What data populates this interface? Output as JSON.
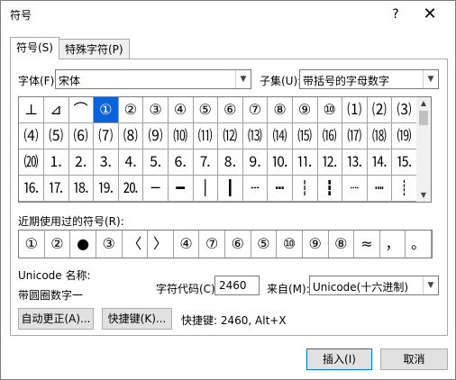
{
  "window": {
    "title": "符号",
    "help": "?",
    "close": "✕"
  },
  "tabs": [
    {
      "label": "符号(S)"
    },
    {
      "label": "特殊字符(P)"
    }
  ],
  "font": {
    "label": "字体(F):",
    "value": "宋体"
  },
  "subset": {
    "label": "子集(U):",
    "value": "带括号的字母数字"
  },
  "symbol_grid": {
    "selected_index": 3,
    "rows": [
      [
        "⊥",
        "⊿",
        "⌒",
        "①",
        "②",
        "③",
        "④",
        "⑤",
        "⑥",
        "⑦",
        "⑧",
        "⑨",
        "⑩",
        "⑴",
        "⑵",
        "⑶"
      ],
      [
        "⑷",
        "⑸",
        "⑹",
        "⑺",
        "⑻",
        "⑼",
        "⑽",
        "⑾",
        "⑿",
        "⒀",
        "⒁",
        "⒂",
        "⒃",
        "⒄",
        "⒅",
        "⒆"
      ],
      [
        "⒇",
        "⒈",
        "⒉",
        "⒊",
        "⒋",
        "⒌",
        "⒍",
        "⒎",
        "⒏",
        "⒐",
        "⒑",
        "⒒",
        "⒓",
        "⒔",
        "⒕",
        "⒖"
      ],
      [
        "⒗",
        "⒘",
        "⒙",
        "⒚",
        "⒛",
        "─",
        "━",
        "│",
        "┃",
        "┄",
        "┅",
        "┆",
        "┇",
        "┈",
        "┉",
        "┊"
      ]
    ]
  },
  "recent": {
    "label": "近期使用过的符号(R):",
    "symbols": [
      "①",
      "②",
      "●",
      "③",
      "〈",
      "〉",
      "④",
      "⑦",
      "⑥",
      "⑤",
      "⑩",
      "⑨",
      "⑧",
      "≈",
      "，",
      "。"
    ]
  },
  "unicode_name": {
    "label": "Unicode 名称:",
    "value": "带圆圈数字一"
  },
  "char_code": {
    "label": "字符代码(C):",
    "value": "2460"
  },
  "from": {
    "label": "来自(M):",
    "value": "Unicode(十六进制)"
  },
  "buttons": {
    "autocorrect": "自动更正(A)...",
    "shortcut_key": "快捷键(K)...",
    "insert": "插入(I)",
    "cancel": "取消"
  },
  "shortcut_text": "快捷键: 2460, Alt+X"
}
